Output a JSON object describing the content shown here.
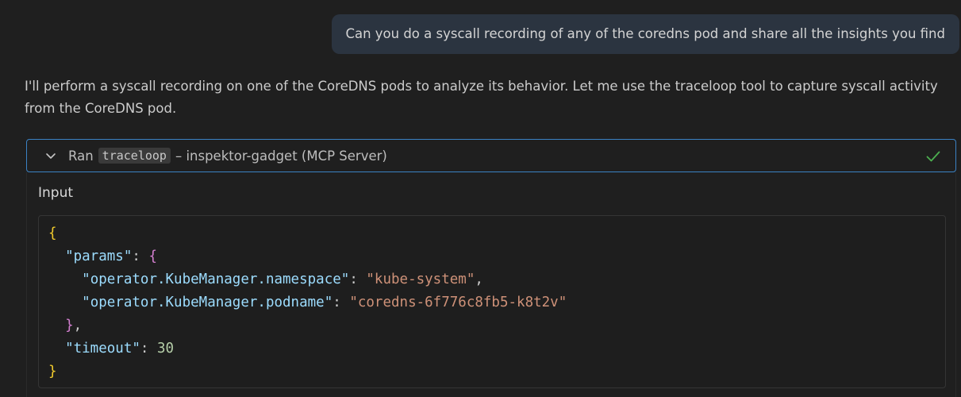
{
  "user_message": "Can you do a syscall recording of any of the coredns pod and share all the insights you find",
  "assistant_message": "I'll perform a syscall recording on one of the CoreDNS pods to analyze its behavior. Let me use the traceloop tool to capture syscall activity from the CoreDNS pod.",
  "tool_call": {
    "prefix": "Ran",
    "tool_name": "traceloop",
    "suffix": "– inspektor-gadget (MCP Server)",
    "status_icon": "check-icon",
    "status_color": "#4caf50",
    "input_label": "Input",
    "code": {
      "open_brace": "{",
      "params_key": "\"params\"",
      "colon": ": ",
      "params_open": "{",
      "ns_key": "\"operator.KubeManager.namespace\"",
      "ns_value": "\"kube-system\"",
      "comma": ",",
      "pod_key": "\"operator.KubeManager.podname\"",
      "pod_value": "\"coredns-6f776c8fb5-k8t2v\"",
      "params_close": "}",
      "timeout_key": "\"timeout\"",
      "timeout_value": "30",
      "close_brace": "}"
    }
  }
}
